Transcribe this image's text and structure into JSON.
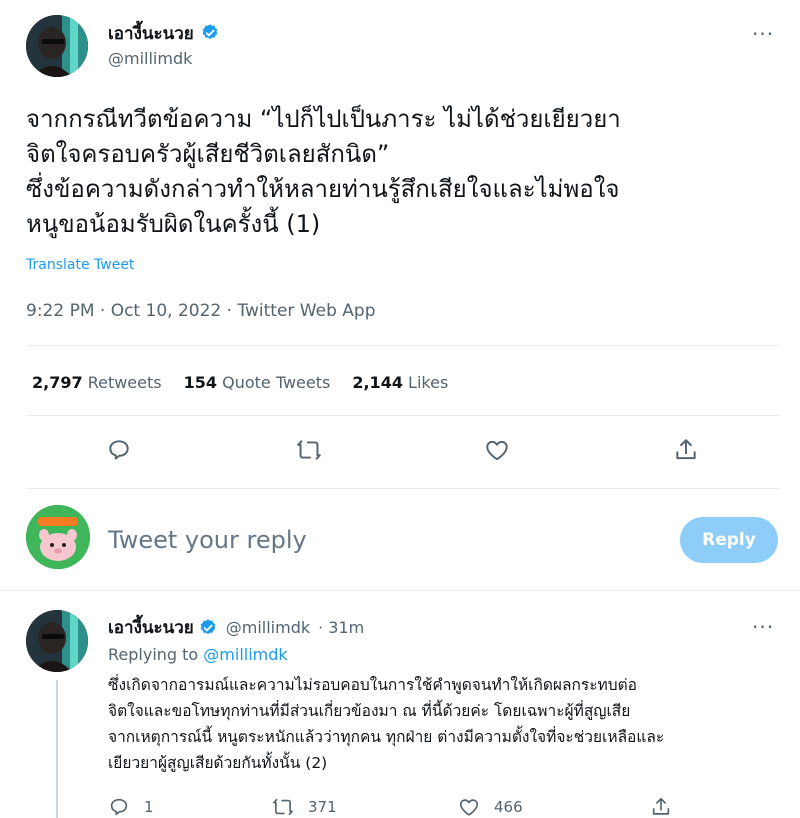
{
  "tweet": {
    "author_name": "เอางี้นะนวย",
    "author_handle": "@millimdk",
    "more_label": "···",
    "text": "จากกรณีทวีตข้อความ “ไปก็ไปเป็นภาระ ไม่ได้ช่วยเยียวยา\nจิตใจครอบครัวผู้เสียชีวิตเลยสักนิด”\nซึ่งข้อความดังกล่าวทำให้หลายท่านรู้สึกเสียใจและไม่พอใจ\nหนูขอน้อมรับผิดในครั้งนี้ (1)",
    "translate_label": "Translate Tweet",
    "timestamp": "9:22 PM · Oct 10, 2022 · Twitter Web App",
    "stats": {
      "retweets_count": "2,797",
      "retweets_label": "Retweets",
      "quotes_count": "154",
      "quotes_label": "Quote Tweets",
      "likes_count": "2,144",
      "likes_label": "Likes"
    }
  },
  "reply_box": {
    "placeholder": "Tweet your reply",
    "button_label": "Reply"
  },
  "reply": {
    "author_name": "เอางี้นะนวย",
    "author_handle": "@millimdk",
    "time": "· 31m",
    "more_label": "···",
    "replying_prefix": "Replying to",
    "replying_handle": "@millimdk",
    "text": "ซึ่งเกิดจากอารมณ์และความไม่รอบคอบในการใช้คำพูดจนทำให้เกิดผลกระทบต่อ\nจิตใจและขอโทษทุกท่านที่มีส่วนเกี่ยวข้องมา ณ ที่นี้ด้วยค่ะ โดยเฉพาะผู้ที่สูญเสีย\nจากเหตุการณ์นี้ หนูตระหนักแล้วว่าทุกคน ทุกฝ่าย ต่างมีความตั้งใจที่จะช่วยเหลือและ\nเยียวยาผู้สูญเสียด้วยกันทั้งนั้น (2)",
    "reply_count": "1",
    "retweet_count": "371",
    "like_count": "466"
  },
  "colors": {
    "accent": "#1d9bf0",
    "reply_button_disabled": "#8ecdf8",
    "secondary_text": "#536471",
    "divider": "#e6ecf0",
    "verified_badge": "#1d9bf0"
  },
  "icons": [
    "verified-badge-icon",
    "more-icon",
    "reply-icon",
    "retweet-icon",
    "like-icon",
    "share-icon"
  ]
}
